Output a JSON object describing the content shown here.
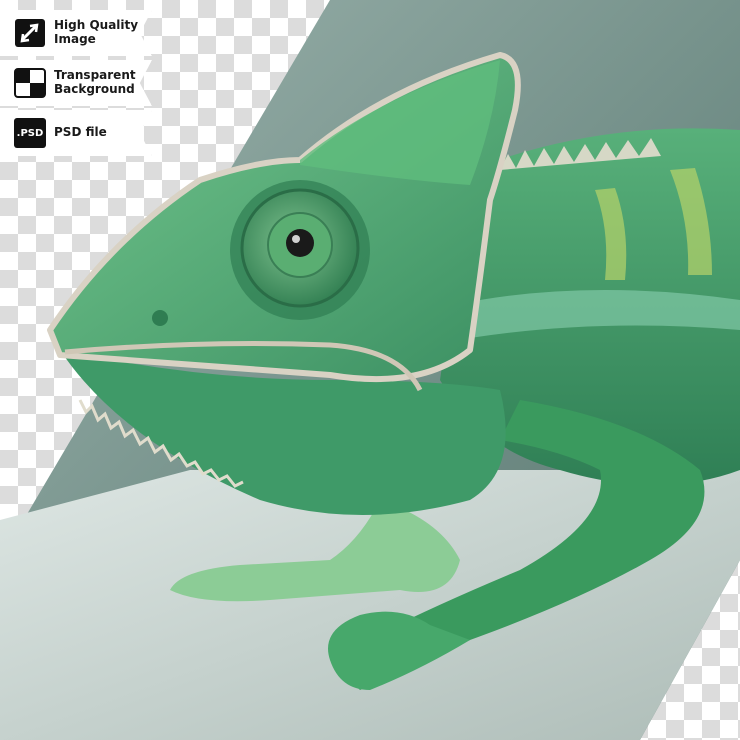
{
  "badges": [
    {
      "icon": "image-quality-icon",
      "lines": [
        "High Quality",
        "Image"
      ]
    },
    {
      "icon": "transparency-checker-icon",
      "lines": [
        "Transparent",
        "Background"
      ]
    },
    {
      "icon": "psd-file-icon",
      "label": ".PSD",
      "lines": [
        "PSD file"
      ]
    }
  ],
  "subject": "green chameleon",
  "colors": {
    "chameleon_main": "#3f9c6a",
    "chameleon_light": "#6cc38a",
    "crest_edge": "#d9d2c4",
    "backdrop": "#7d9a93",
    "floor": "#c9d3cf"
  }
}
